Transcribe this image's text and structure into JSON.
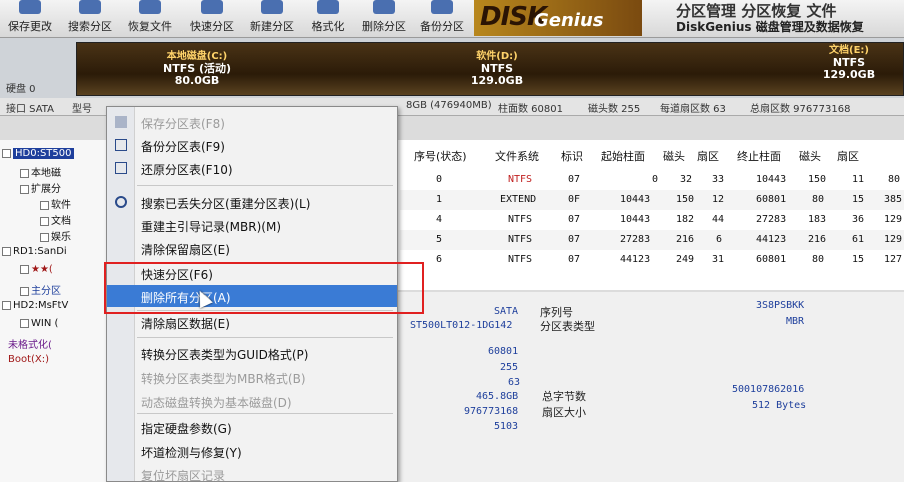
{
  "toolbar": {
    "buttons": [
      {
        "label": "保存更改",
        "icon": "save-icon"
      },
      {
        "label": "搜索分区",
        "icon": "search-icon"
      },
      {
        "label": "恢复文件",
        "icon": "recover-file-icon"
      },
      {
        "label": "快速分区",
        "icon": "quick-partition-icon"
      },
      {
        "label": "新建分区",
        "icon": "new-partition-icon"
      },
      {
        "label": "格式化",
        "icon": "format-icon"
      },
      {
        "label": "删除分区",
        "icon": "delete-partition-icon"
      },
      {
        "label": "备份分区",
        "icon": "backup-partition-icon"
      }
    ],
    "logo": "DISK",
    "logo_sub": "Genius",
    "slogan": "分区管理 分区恢复 文件",
    "brand": "DiskGenius 磁盘管理及数据恢复"
  },
  "disk_bar": {
    "left_label": "硬盘 0",
    "partitions": [
      {
        "name": "本地磁盘(C:)",
        "fs": "NTFS (活动)",
        "size": "80.0GB"
      },
      {
        "name": "软件(D:)",
        "fs": "NTFS",
        "size": "129.0GB"
      },
      {
        "name": "文档(E:)",
        "fs": "NTFS",
        "size": "129.0GB"
      }
    ]
  },
  "info_strip": {
    "iface": "接口 SATA",
    "model": "型号",
    "capacity": "8GB (476940MB)",
    "cylinders": "柱面数 60801",
    "heads": "磁头数 255",
    "sectors": "每道扇区数 63",
    "total_sectors": "总扇区数 976773168"
  },
  "tree": {
    "items": [
      "HD0:ST500",
      "本地磁",
      "扩展分",
      "软件",
      "文档",
      "娱乐",
      "RD1:SanDi",
      "★★(",
      "主分区",
      "HD2:MsFtV",
      "WIN (",
      "未格式化(",
      "Boot(X:)"
    ]
  },
  "table": {
    "headers": [
      "序号(状态)",
      "文件系统",
      "标识",
      "起始柱面",
      "磁头",
      "扇区",
      "终止柱面",
      "磁头",
      "扇区"
    ],
    "rows": [
      [
        "0",
        "NTFS",
        "07",
        "0",
        "32",
        "33",
        "10443",
        "150",
        "11",
        "80"
      ],
      [
        "1",
        "EXTEND",
        "0F",
        "10443",
        "150",
        "12",
        "60801",
        "80",
        "15",
        "385"
      ],
      [
        "4",
        "NTFS",
        "07",
        "10443",
        "182",
        "44",
        "27283",
        "183",
        "36",
        "129"
      ],
      [
        "5",
        "NTFS",
        "07",
        "27283",
        "216",
        "6",
        "44123",
        "216",
        "61",
        "129"
      ],
      [
        "6",
        "NTFS",
        "07",
        "44123",
        "249",
        "31",
        "60801",
        "80",
        "15",
        "127"
      ]
    ]
  },
  "details": {
    "iface_val": "SATA",
    "model_val": "ST500LT012-1DG142",
    "serial_label": "序列号",
    "serial_val": "3S8PSBKK",
    "pt_label": "分区表类型",
    "pt_val": "MBR",
    "cylinders_val": "60801",
    "heads_val": "255",
    "sectors_val": "63",
    "capacity_val": "465.8GB",
    "total_sectors_val": "976773168",
    "extra_val": "5103",
    "total_bytes_label": "总字节数",
    "total_bytes_val": "500107862016",
    "sector_size_label": "扇区大小",
    "sector_size_val": "512 Bytes"
  },
  "menu": {
    "items": [
      {
        "label": "保存分区表(F8)",
        "disabled": true,
        "icon": "save-table-icon"
      },
      {
        "label": "备份分区表(F9)",
        "disabled": false,
        "icon": "backup-table-icon"
      },
      {
        "label": "还原分区表(F10)",
        "disabled": false,
        "icon": "restore-table-icon"
      },
      {
        "label": "搜索已丢失分区(重建分区表)(L)",
        "disabled": false,
        "icon": "search-lost-icon"
      },
      {
        "label": "重建主引导记录(MBR)(M)",
        "disabled": false,
        "icon": ""
      },
      {
        "label": "清除保留扇区(E)",
        "disabled": false,
        "icon": ""
      },
      {
        "label": "快速分区(F6)",
        "disabled": false,
        "icon": ""
      },
      {
        "label": "删除所有分区(A)",
        "disabled": false,
        "icon": ""
      },
      {
        "label": "清除扇区数据(E)",
        "disabled": false,
        "icon": ""
      },
      {
        "label": "转换分区表类型为GUID格式(P)",
        "disabled": false,
        "icon": ""
      },
      {
        "label": "转换分区表类型为MBR格式(B)",
        "disabled": true,
        "icon": ""
      },
      {
        "label": "动态磁盘转换为基本磁盘(D)",
        "disabled": true,
        "icon": ""
      },
      {
        "label": "指定硬盘参数(G)",
        "disabled": false,
        "icon": ""
      },
      {
        "label": "坏道检测与修复(Y)",
        "disabled": false,
        "icon": ""
      },
      {
        "label": "复位坏扇区记录",
        "disabled": true,
        "icon": ""
      }
    ]
  }
}
